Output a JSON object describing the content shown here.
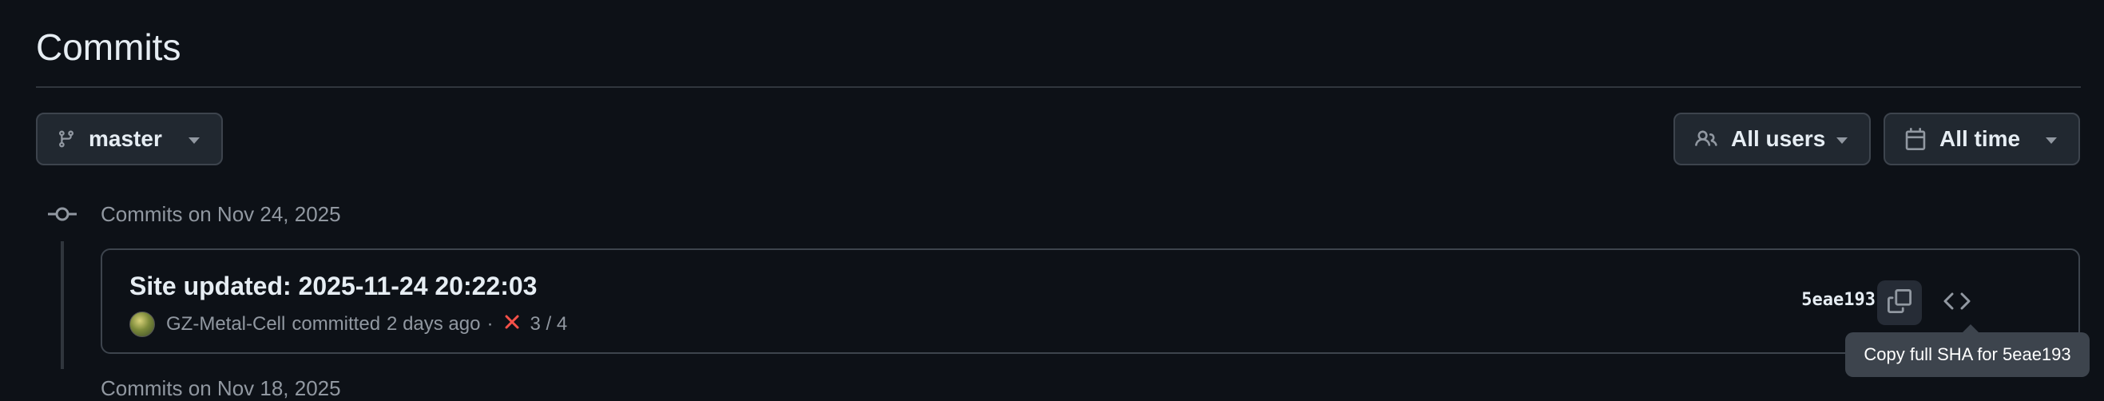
{
  "page": {
    "title": "Commits"
  },
  "filters": {
    "branch_label": "master",
    "users_label": "All users",
    "time_label": "All time"
  },
  "groups": [
    {
      "heading": "Commits on Nov 24, 2025",
      "commits": [
        {
          "title": "Site updated: 2025-11-24 20:22:03",
          "author": "GZ-Metal-Cell",
          "action": "committed",
          "time_ago": "2 days ago",
          "separator": "·",
          "checks": "3 / 4",
          "check_status": "failure",
          "sha_short": "5eae193"
        }
      ]
    },
    {
      "heading": "Commits on Nov 18, 2025"
    }
  ],
  "tooltip": {
    "text": "Copy full SHA for 5eae193"
  },
  "icons": {
    "branch": "git-branch-icon",
    "users": "people-icon",
    "calendar": "calendar-icon",
    "caret": "triangle-down-icon",
    "timeline": "git-commit-icon",
    "fail": "x-icon",
    "copy": "copy-icon",
    "browse": "code-icon"
  },
  "colors": {
    "background": "#0d1117",
    "border": "#3d444d",
    "text": "#e6edf3",
    "muted": "#9198a1",
    "danger": "#f85149"
  }
}
